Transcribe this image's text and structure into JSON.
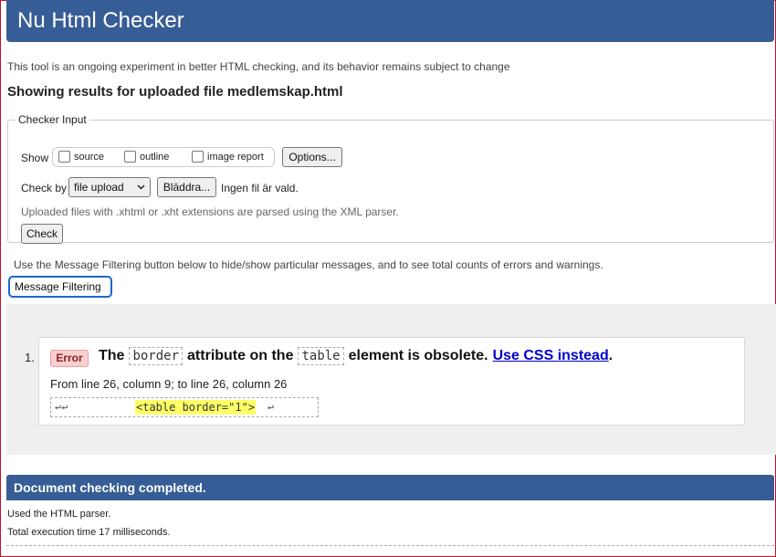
{
  "header": {
    "title": "Nu Html Checker"
  },
  "intro": "This tool is an ongoing experiment in better HTML checking, and its behavior remains subject to change",
  "results_heading": "Showing results for uploaded file medlemskap.html",
  "checker_input": {
    "legend": "Checker Input",
    "show_label": "Show",
    "show_options": [
      {
        "label": "source",
        "checked": false
      },
      {
        "label": "outline",
        "checked": false
      },
      {
        "label": "image report",
        "checked": false
      }
    ],
    "options_button": "Options...",
    "check_by_label": "Check by",
    "check_by_value": "file upload",
    "browse_button": "Bläddra...",
    "no_file_text": "Ingen fil är vald.",
    "parser_note": "Uploaded files with .xhtml or .xht extensions are parsed using the XML parser.",
    "check_button": "Check"
  },
  "filter": {
    "info": "Use the Message Filtering button below to hide/show particular messages, and to see total counts of errors and warnings.",
    "button": "Message Filtering"
  },
  "messages": [
    {
      "number": "1.",
      "type": "Error",
      "text_1": "The",
      "code_1": "border",
      "text_2": "attribute on the",
      "code_2": "table",
      "text_3": "element is obsolete.",
      "link": "Use CSS instead",
      "text_4": ".",
      "location": "From line 26, column 9; to line 26, column 26",
      "extract_marks": "↩↩",
      "extract_code": "<table border=\"1\">",
      "extract_end": "↩"
    }
  ],
  "footer": {
    "status": "Document checking completed.",
    "parser_used": "Used the HTML parser.",
    "exec_time": "Total execution time 17 milliseconds."
  },
  "colors": {
    "header_bg": "#365d95",
    "error_badge_bg": "#f9cfd0",
    "highlight": "#ffff66",
    "link": "#0000cc",
    "focus_ring": "#1967d2"
  }
}
